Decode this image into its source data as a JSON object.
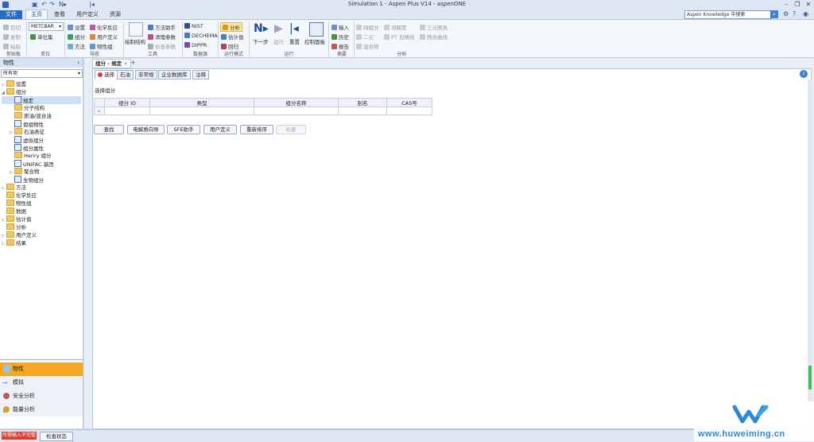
{
  "window": {
    "title": "Simulation 1 - Aspen Plus V14 - aspenONE"
  },
  "ribbon_tabs": [
    "文件",
    "主页",
    "查看",
    "用户定义",
    "资源"
  ],
  "search": {
    "placeholder": "Aspen Knowledge 中搜索"
  },
  "ribbon": {
    "clipboard": {
      "cut": "剪切",
      "copy": "复制",
      "paste": "粘贴",
      "label": "剪贴板"
    },
    "units": {
      "unit_set": "METCBAR",
      "unit_sets": "单位集",
      "label": "单位"
    },
    "nav": {
      "setup": "设置",
      "components": "组分",
      "methods": "方法",
      "chem": "化学反应",
      "user_def": "用户定义",
      "prop_sets": "物性组",
      "label": "导航"
    },
    "tools": {
      "draw": "绘制结构",
      "method_assist": "方法助手",
      "clean_params": "清理参数",
      "check_params": "检查参数",
      "label": "工具"
    },
    "data_source": {
      "nist": "NIST",
      "dechema": "DECHEMA",
      "dippr": "DIPPR",
      "label": "数据源"
    },
    "run_mode": {
      "analysis": "分析",
      "estimation": "估计值",
      "regression": "回归",
      "label": "运行模式"
    },
    "run": {
      "next": "下一步",
      "run": "运行",
      "reset": "重置",
      "control_panel": "控制面板",
      "label": "运行"
    },
    "summary": {
      "input": "输入",
      "history": "历史",
      "report": "报告",
      "label": "摘要"
    },
    "analysis": {
      "pure": "纯组分",
      "binary": "二元",
      "mixture": "混合物",
      "residue": "溶解度",
      "pt": "PT 包络线",
      "ternary": "三元图表",
      "ternary2": "残余曲线",
      "label": "分析"
    }
  },
  "left_panel": {
    "title": "物性",
    "filter": "所有项",
    "tree": [
      {
        "label": "设置",
        "level": 0,
        "arrow": "▷",
        "icon": "folder"
      },
      {
        "label": "组分",
        "level": 0,
        "arrow": "◢",
        "icon": "folder"
      },
      {
        "label": "规定",
        "level": 1,
        "arrow": "",
        "icon": "form"
      },
      {
        "label": "分子结构",
        "level": 1,
        "arrow": "",
        "icon": "folder"
      },
      {
        "label": "原油/混合油",
        "level": 1,
        "arrow": "",
        "icon": "folder"
      },
      {
        "label": "假组物性",
        "level": 1,
        "arrow": "",
        "icon": "form"
      },
      {
        "label": "石油表征",
        "level": 1,
        "arrow": "▷",
        "icon": "folder"
      },
      {
        "label": "虚拟组分",
        "level": 1,
        "arrow": "",
        "icon": "form"
      },
      {
        "label": "组分属性",
        "level": 1,
        "arrow": "",
        "icon": "form"
      },
      {
        "label": "Henry 组分",
        "level": 1,
        "arrow": "",
        "icon": "folder"
      },
      {
        "label": "UNIFAC 基团",
        "level": 1,
        "arrow": "",
        "icon": "form"
      },
      {
        "label": "聚合物",
        "level": 1,
        "arrow": "▷",
        "icon": "folder"
      },
      {
        "label": "生物组分",
        "level": 1,
        "arrow": "",
        "icon": "form"
      },
      {
        "label": "方法",
        "level": 0,
        "arrow": "▷",
        "icon": "folder"
      },
      {
        "label": "化学反应",
        "level": 0,
        "arrow": "",
        "icon": "folder"
      },
      {
        "label": "物性组",
        "level": 0,
        "arrow": "",
        "icon": "folder"
      },
      {
        "label": "数据",
        "level": 0,
        "arrow": "",
        "icon": "folder"
      },
      {
        "label": "估计值",
        "level": 0,
        "arrow": "▷",
        "icon": "folder"
      },
      {
        "label": "分析",
        "level": 0,
        "arrow": "",
        "icon": "folder"
      },
      {
        "label": "用户定义",
        "level": 0,
        "arrow": "▷",
        "icon": "folder"
      },
      {
        "label": "结果",
        "level": 0,
        "arrow": "▷",
        "icon": "folder"
      }
    ]
  },
  "nav_pane": [
    {
      "label": "物性",
      "active": true
    },
    {
      "label": "模拟",
      "active": false
    },
    {
      "label": "安全分析",
      "active": false
    },
    {
      "label": "能量分析",
      "active": false
    }
  ],
  "doc_tab": {
    "label": "组分 - 规定",
    "close": "×",
    "add": "+"
  },
  "sub_tabs": [
    "选择",
    "石油",
    "非常规",
    "企业数据库",
    "注释"
  ],
  "section": {
    "title": "选择组分"
  },
  "grid": {
    "headers": [
      "组分 ID",
      "类型",
      "组分名称",
      "别名",
      "CAS号"
    ]
  },
  "buttons": [
    "查找",
    "电解质向导",
    "SFE助手",
    "用户定义",
    "重新排序",
    "检查"
  ],
  "status": {
    "error": "所需输入不完整",
    "check": "检查状态"
  },
  "watermark": {
    "text": "www.huweiming.cn"
  },
  "colors": {
    "accent": "#2a6cc3",
    "active_nav": "#f5a623",
    "error": "#e23b2e"
  }
}
